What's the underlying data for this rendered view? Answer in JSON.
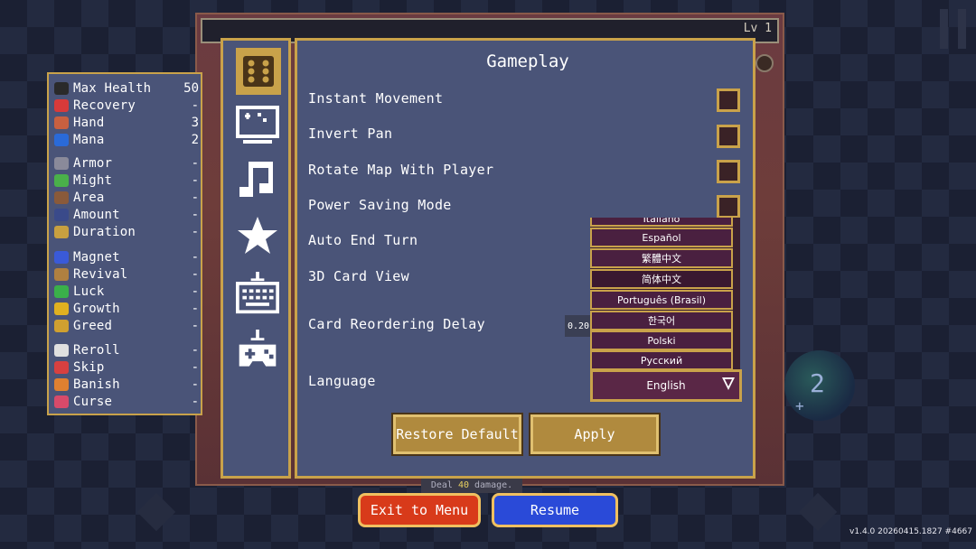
{
  "hud": {
    "level": "Lv 1",
    "deck_count": "2",
    "deck_plus": "+",
    "tooltip_prefix": "Deal ",
    "tooltip_value": "40",
    "tooltip_suffix": " damage.",
    "version": "v1.4.0 20260415.1827 #4667"
  },
  "stats": [
    {
      "label": "Max Health",
      "value": "50",
      "icon": "heart-icon",
      "color": "#2a2a2a"
    },
    {
      "label": "Recovery",
      "value": "-",
      "icon": "heart-plus-icon",
      "color": "#d83a3a"
    },
    {
      "label": "Hand",
      "value": "3",
      "icon": "hand-icon",
      "color": "#c86040"
    },
    {
      "label": "Mana",
      "value": "2",
      "icon": "mana-orb-icon",
      "color": "#2a6ad8"
    },
    {
      "label": "Armor",
      "value": "-",
      "icon": "armor-icon",
      "color": "#8a8a9a"
    },
    {
      "label": "Might",
      "value": "-",
      "icon": "might-icon",
      "color": "#4ab04a"
    },
    {
      "label": "Area",
      "value": "-",
      "icon": "area-icon",
      "color": "#8a5a3a"
    },
    {
      "label": "Amount",
      "value": "-",
      "icon": "amount-icon",
      "color": "#3a4a8a"
    },
    {
      "label": "Duration",
      "value": "-",
      "icon": "duration-icon",
      "color": "#c8a040"
    },
    {
      "label": "Magnet",
      "value": "-",
      "icon": "magnet-icon",
      "color": "#3a5ad8"
    },
    {
      "label": "Revival",
      "value": "-",
      "icon": "revival-icon",
      "color": "#b08040"
    },
    {
      "label": "Luck",
      "value": "-",
      "icon": "clover-icon",
      "color": "#3ab04a"
    },
    {
      "label": "Growth",
      "value": "-",
      "icon": "crown-icon",
      "color": "#e0b020"
    },
    {
      "label": "Greed",
      "value": "-",
      "icon": "greed-icon",
      "color": "#d0a030"
    },
    {
      "label": "Reroll",
      "value": "-",
      "icon": "dice-icon",
      "color": "#e0e0e0"
    },
    {
      "label": "Skip",
      "value": "-",
      "icon": "skip-icon",
      "color": "#d84040"
    },
    {
      "label": "Banish",
      "value": "-",
      "icon": "banish-icon",
      "color": "#e08030"
    },
    {
      "label": "Curse",
      "value": "-",
      "icon": "skull-icon",
      "color": "#d84a6a"
    }
  ],
  "settings": {
    "title": "Gameplay",
    "options": [
      "Instant Movement",
      "Invert Pan",
      "Rotate Map With Player",
      "Power Saving Mode",
      "Auto End Turn",
      "3D Card View",
      "Card Reordering Delay",
      "Language"
    ],
    "card_delay_value": "0.20",
    "language_options_visible": [
      "Italiano",
      "Español",
      "繁體中文",
      "简体中文",
      "Português (Brasil)",
      "한국어",
      "Polski",
      "Русский"
    ],
    "language_selected": "English",
    "restore_label": "Restore Default",
    "apply_label": "Apply"
  },
  "footer": {
    "exit_label": "Exit to Menu",
    "resume_label": "Resume"
  },
  "colors": {
    "gold": "#c9a24a",
    "panel": "#4a5478",
    "exit": "#d83a1a",
    "resume": "#2a4ad8"
  }
}
